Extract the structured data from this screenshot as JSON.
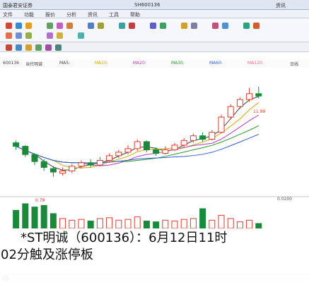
{
  "window": {
    "title_left": "国泰君安证券",
    "title_mid": "SH600136",
    "title_right": "资讯"
  },
  "menu": {
    "items": [
      "文件",
      "功能",
      "报价",
      "分析",
      "资讯",
      "工具",
      "帮助"
    ]
  },
  "stock": {
    "code": "600136",
    "name": "当代明诚",
    "period": "日线"
  },
  "indicators": {
    "ma5": "MA5:",
    "ma10": "MA10:",
    "ma20": "MA20:",
    "ma30": "MA30:",
    "ma60": "MA60:",
    "ma120": "MA120:"
  },
  "price_labels": {
    "high_marker": "11.99",
    "low_marker": "0.79",
    "axis_low": "0.0200"
  },
  "caption": {
    "line1": "*ST明诚（600136）：6月12日11时",
    "line2": "02分触及涨停板"
  },
  "colors": {
    "up": "#e23a2e",
    "down": "#1a8a3a",
    "ma_white": "#444444",
    "ma_yellow": "#d9a400",
    "ma_purple": "#b040c0",
    "ma_green": "#2a9a2a",
    "ma_blue": "#2f5fd0",
    "ma_pink": "#ff6a8a"
  },
  "chart_data": {
    "type": "candlestick",
    "candles": [
      {
        "o": 7.2,
        "c": 6.9,
        "h": 7.4,
        "l": 6.6
      },
      {
        "o": 6.9,
        "c": 6.2,
        "h": 7.0,
        "l": 6.0
      },
      {
        "o": 6.2,
        "c": 5.6,
        "h": 6.3,
        "l": 5.3
      },
      {
        "o": 5.6,
        "c": 5.1,
        "h": 5.8,
        "l": 4.8
      },
      {
        "o": 5.0,
        "c": 4.7,
        "h": 5.2,
        "l": 4.3
      },
      {
        "o": 4.6,
        "c": 4.8,
        "h": 5.1,
        "l": 4.4
      },
      {
        "o": 4.8,
        "c": 5.2,
        "h": 5.4,
        "l": 4.6
      },
      {
        "o": 5.2,
        "c": 5.5,
        "h": 5.7,
        "l": 5.0
      },
      {
        "o": 5.5,
        "c": 5.3,
        "h": 5.8,
        "l": 5.1
      },
      {
        "o": 5.3,
        "c": 5.7,
        "h": 6.0,
        "l": 5.2
      },
      {
        "o": 5.7,
        "c": 6.1,
        "h": 6.3,
        "l": 5.5
      },
      {
        "o": 6.1,
        "c": 6.4,
        "h": 6.6,
        "l": 5.9
      },
      {
        "o": 6.4,
        "c": 6.7,
        "h": 7.0,
        "l": 6.2
      },
      {
        "o": 6.7,
        "c": 7.3,
        "h": 7.5,
        "l": 6.5
      },
      {
        "o": 7.3,
        "c": 6.6,
        "h": 7.4,
        "l": 6.4
      },
      {
        "o": 6.6,
        "c": 6.3,
        "h": 6.8,
        "l": 6.1
      },
      {
        "o": 6.3,
        "c": 6.6,
        "h": 6.9,
        "l": 6.2
      },
      {
        "o": 6.6,
        "c": 7.0,
        "h": 7.2,
        "l": 6.5
      },
      {
        "o": 7.0,
        "c": 7.4,
        "h": 7.6,
        "l": 6.8
      },
      {
        "o": 7.4,
        "c": 7.8,
        "h": 8.0,
        "l": 7.2
      },
      {
        "o": 7.8,
        "c": 7.5,
        "h": 8.1,
        "l": 7.3
      },
      {
        "o": 7.5,
        "c": 8.1,
        "h": 8.3,
        "l": 7.4
      },
      {
        "o": 8.1,
        "c": 9.4,
        "h": 9.6,
        "l": 8.0
      },
      {
        "o": 9.4,
        "c": 10.3,
        "h": 10.5,
        "l": 9.2
      },
      {
        "o": 10.3,
        "c": 10.9,
        "h": 11.1,
        "l": 10.1
      },
      {
        "o": 10.9,
        "c": 11.4,
        "h": 11.9,
        "l": 10.7
      },
      {
        "o": 11.4,
        "c": 11.2,
        "h": 11.99,
        "l": 11.0
      }
    ],
    "ylim": [
      3.5,
      13.5
    ],
    "volumes": [
      22,
      30,
      26,
      28,
      18,
      12,
      10,
      11,
      9,
      12,
      13,
      10,
      11,
      14,
      9,
      8,
      10,
      9,
      11,
      12,
      24,
      10,
      16,
      12,
      8,
      10,
      6
    ]
  }
}
